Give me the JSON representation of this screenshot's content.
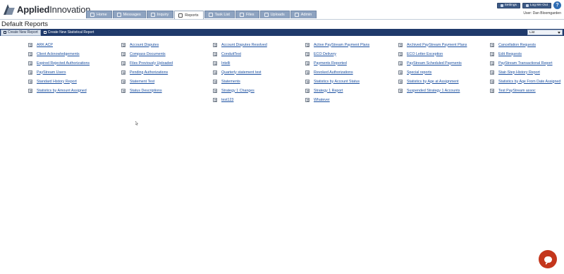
{
  "app": {
    "logo_text_bold": "Applied",
    "logo_text": "Innovation"
  },
  "nav": {
    "tabs": [
      {
        "label": "Home",
        "icon": "home-icon"
      },
      {
        "label": "Messages",
        "icon": "messages-icon"
      },
      {
        "label": "Inquiry",
        "icon": "inquiry-icon"
      },
      {
        "label": "Reports",
        "icon": "reports-icon",
        "active": true
      },
      {
        "label": "Task List",
        "icon": "task-list-icon"
      },
      {
        "label": "Files",
        "icon": "files-icon"
      },
      {
        "label": "Uploads",
        "icon": "uploads-icon"
      },
      {
        "label": "Admin",
        "icon": "admin-icon"
      }
    ]
  },
  "util": {
    "settings": "Settings",
    "logout": "Log Me Out",
    "help": "?",
    "user": "User: Dan Bloomgarden"
  },
  "page": {
    "title": "Default Reports"
  },
  "toolbar": {
    "create_report": "Create New Report",
    "create_statistical": "Create New Statistical Report",
    "view_select": "List"
  },
  "reports": {
    "columns": [
      [
        "ARK ACP",
        "Client Acknowledgements",
        "Expired Rejected Authorizations",
        "PayStream Users",
        "Standard History Report",
        "Statistics by Amount Assigned"
      ],
      [
        "Account Disputes",
        "Compass Documents",
        "Files Previously Uploaded",
        "Pending Authorizations",
        "Statement Test",
        "Status Descriptions"
      ],
      [
        "Account Disputes Resolved",
        "ConduitTest",
        "Intelli",
        "Quarterly statement test",
        "Statements",
        "Strategy 1 Changes",
        "test123"
      ],
      [
        "Active PayStream Payment Plans",
        "ECO Delivery",
        "Payments Reported",
        "Revoked Authorizations",
        "Statistics by Account Status",
        "Strategy 1 Report",
        "Whatever"
      ],
      [
        "Archived PayStream Payment Plans",
        "ECO Letter Exception",
        "PayStream Scheduled Payments",
        "Special reports",
        "Statistics by Age at Assignment",
        "Suspended Strategy 1 Accounts"
      ],
      [
        "Cancellation Requests",
        "Edit Requests",
        "PayStream Transactional Report",
        "Stair-Step History Report",
        "Statistics by Age From Date Assigned",
        "Test PayStream assoc"
      ]
    ]
  },
  "colors": {
    "toolbar": "#1f3a6b",
    "link": "#1a4fa0",
    "chat": "#c4361c"
  }
}
